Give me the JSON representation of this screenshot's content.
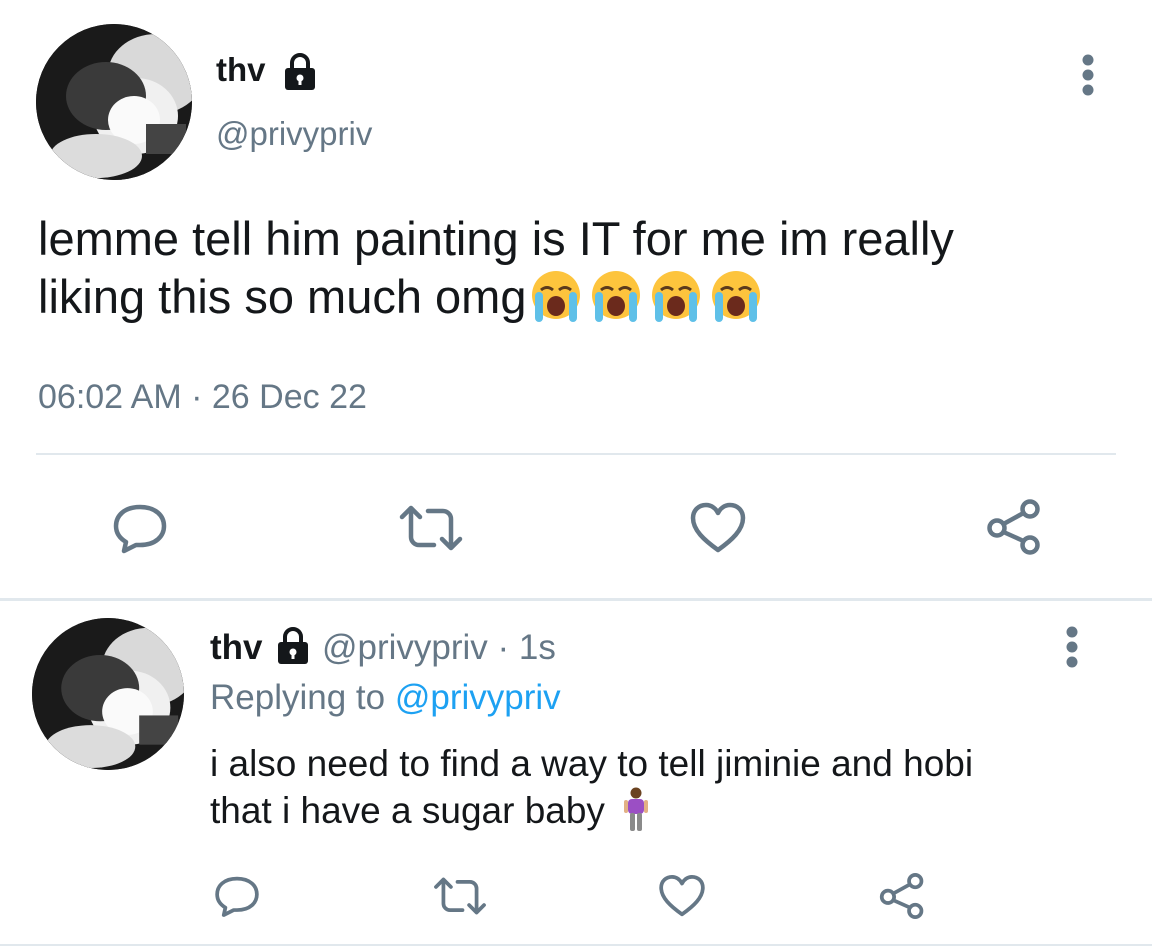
{
  "main_tweet": {
    "display_name": "thv",
    "handle": "@privypriv",
    "text": "lemme tell him painting is IT for me im really liking this so much omg",
    "text_line1": "lemme tell him painting is IT for me im really",
    "text_line2": "liking this so much omg",
    "emojis": [
      "loudly-crying-face",
      "loudly-crying-face",
      "loudly-crying-face",
      "loudly-crying-face"
    ],
    "time": "06:02 AM",
    "separator": "·",
    "date": "26 Dec 22",
    "actions": [
      "reply",
      "retweet",
      "like",
      "share"
    ]
  },
  "reply_tweet": {
    "display_name": "thv",
    "handle": "@privypriv",
    "separator": "·",
    "age": "1s",
    "replying_prefix": "Replying to",
    "replying_handle": "@privypriv",
    "text_line1": "i also need to find a way to tell jiminie and hobi",
    "text_line2": "that i have a sugar baby",
    "emoji": "person-standing",
    "actions": [
      "reply",
      "retweet",
      "like",
      "share"
    ]
  },
  "colors": {
    "text": "#14171a",
    "muted": "#657786",
    "link": "#1da1f2",
    "divider": "#e1e8ed",
    "icon": "#657786"
  }
}
